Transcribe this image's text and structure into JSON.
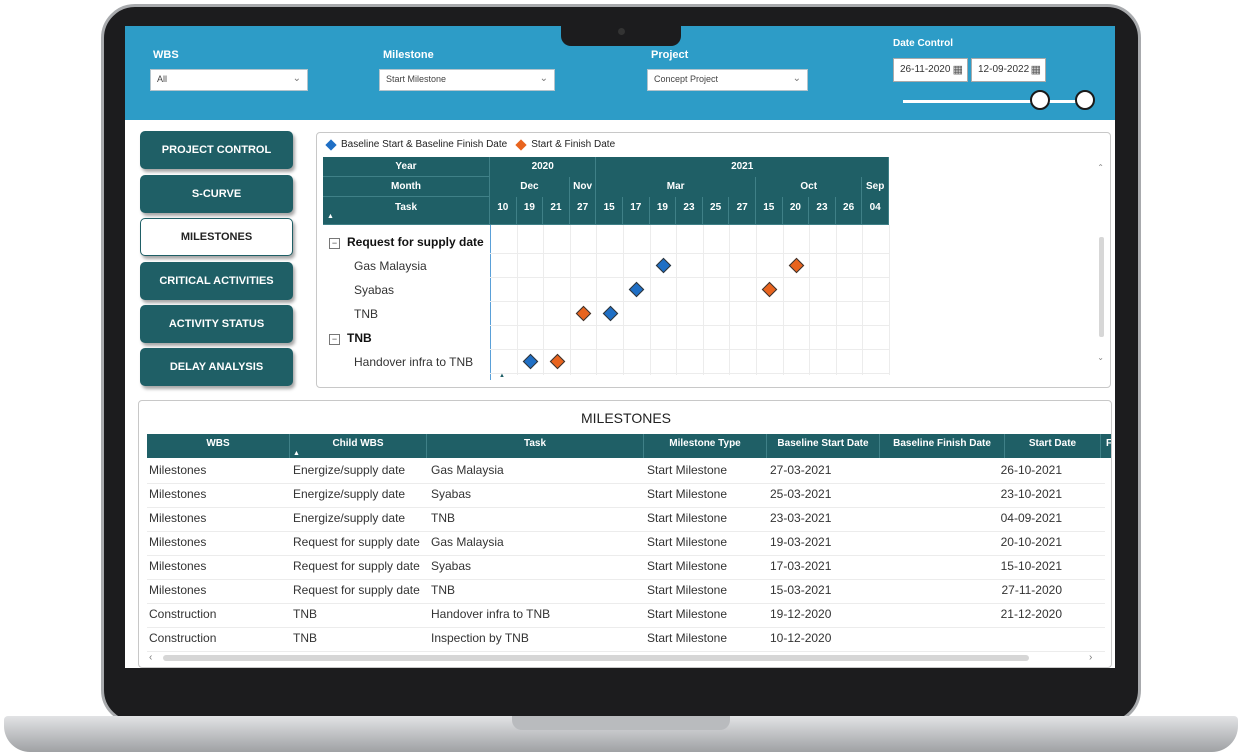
{
  "filters": {
    "wbs": {
      "label": "WBS",
      "value": "All"
    },
    "milestone": {
      "label": "Milestone",
      "value": "Start Milestone"
    },
    "project": {
      "label": "Project",
      "value": "Concept Project"
    },
    "date_control": {
      "label": "Date Control",
      "start": "26-11-2020",
      "end": "12-09-2022",
      "range_fraction": [
        0.72,
        1.0
      ]
    }
  },
  "nav": {
    "items": [
      {
        "label": "PROJECT CONTROL",
        "active": false
      },
      {
        "label": "S-CURVE",
        "active": false
      },
      {
        "label": "MILESTONES",
        "active": true
      },
      {
        "label": "CRITICAL ACTIVITIES",
        "active": false
      },
      {
        "label": "ACTIVITY STATUS",
        "active": false
      },
      {
        "label": "DELAY ANALYSIS",
        "active": false
      }
    ]
  },
  "gantt": {
    "legend": [
      {
        "label": "Baseline Start & Baseline Finish Date",
        "color": "#1f6fc5"
      },
      {
        "label": "Start & Finish Date",
        "color": "#e8641e"
      }
    ],
    "header_labels": {
      "year": "Year",
      "month": "Month",
      "task": "Task"
    },
    "years": [
      "2020",
      "2021"
    ],
    "months": [
      "Dec",
      "Nov",
      "Mar",
      "Oct",
      "Sep"
    ],
    "days": [
      "10",
      "19",
      "21",
      "27",
      "15",
      "17",
      "19",
      "23",
      "25",
      "27",
      "15",
      "20",
      "23",
      "26",
      "04"
    ],
    "rows": [
      {
        "label": "Request for supply date",
        "group": true,
        "expander": "−"
      },
      {
        "label": "Gas Malaysia",
        "group": false,
        "baseline_col": 6,
        "actual_col": 11
      },
      {
        "label": "Syabas",
        "group": false,
        "baseline_col": 5,
        "actual_col": 10
      },
      {
        "label": "TNB",
        "group": false,
        "baseline_col": 4,
        "actual_col": 3
      },
      {
        "label": "TNB",
        "group": true,
        "expander": "−"
      },
      {
        "label": "Handover infra to TNB",
        "group": false,
        "baseline_col": 1,
        "actual_col": 2
      }
    ]
  },
  "table": {
    "title": "MILESTONES",
    "columns": [
      "WBS",
      "Child WBS",
      "Task",
      "Milestone Type",
      "Baseline Start Date",
      "Baseline Finish Date",
      "Start Date",
      "Fi"
    ],
    "rows": [
      [
        "Milestones",
        "Energize/supply date",
        "Gas Malaysia",
        "Start Milestone",
        "27-03-2021",
        "",
        "26-10-2021"
      ],
      [
        "Milestones",
        "Energize/supply date",
        "Syabas",
        "Start Milestone",
        "25-03-2021",
        "",
        "23-10-2021"
      ],
      [
        "Milestones",
        "Energize/supply date",
        "TNB",
        "Start Milestone",
        "23-03-2021",
        "",
        "04-09-2021"
      ],
      [
        "Milestones",
        "Request for supply date",
        "Gas Malaysia",
        "Start Milestone",
        "19-03-2021",
        "",
        "20-10-2021"
      ],
      [
        "Milestones",
        "Request for supply date",
        "Syabas",
        "Start Milestone",
        "17-03-2021",
        "",
        "15-10-2021"
      ],
      [
        "Milestones",
        "Request for supply date",
        "TNB",
        "Start Milestone",
        "15-03-2021",
        "",
        "27-11-2020"
      ],
      [
        "Construction",
        "TNB",
        "Handover infra to TNB",
        "Start Milestone",
        "19-12-2020",
        "",
        "21-12-2020"
      ],
      [
        "Construction",
        "TNB",
        "Inspection by TNB",
        "Start Milestone",
        "10-12-2020",
        "",
        ""
      ]
    ]
  }
}
